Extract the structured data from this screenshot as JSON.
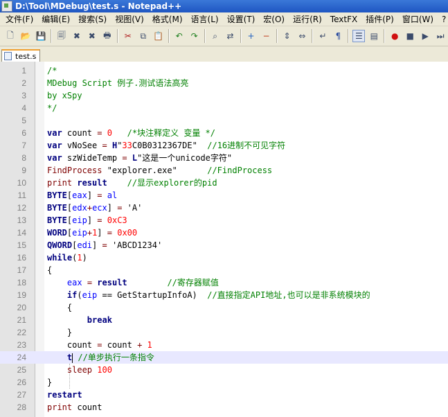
{
  "window": {
    "title": "D:\\Tool\\MDebug\\test.s - Notepad++"
  },
  "menu": [
    "文件(F)",
    "编辑(E)",
    "搜索(S)",
    "视图(V)",
    "格式(M)",
    "语言(L)",
    "设置(T)",
    "宏(O)",
    "运行(R)",
    "TextFX",
    "插件(P)",
    "窗口(W)",
    "?"
  ],
  "toolbar": {
    "icons": [
      "new-file-icon",
      "open-file-icon",
      "save-icon",
      "save-all-icon",
      "close-icon",
      "close-all-icon",
      "print-icon",
      "cut-icon",
      "copy-icon",
      "paste-icon",
      "undo-icon",
      "redo-icon",
      "find-icon",
      "replace-icon",
      "zoom-in-icon",
      "zoom-out-icon",
      "sync-v-icon",
      "sync-h-icon",
      "wrap-icon",
      "show-all-chars-icon",
      "indent-guide-icon",
      "udl-icon",
      "record-icon",
      "stop-icon",
      "play-icon",
      "run-multiple-icon"
    ]
  },
  "tabs": [
    {
      "label": "test.s",
      "active": true
    }
  ],
  "colors": {
    "comment": "#008000",
    "keyword": "#00007f",
    "function": "#7f0000",
    "number": "#ff0000",
    "variable": "#0000ff",
    "current_line": "#e8e8ff"
  },
  "editor": {
    "current_line": 24,
    "lines": [
      {
        "n": "1",
        "tokens": [
          {
            "c": "cm",
            "t": "/*"
          }
        ]
      },
      {
        "n": "2",
        "tokens": [
          {
            "c": "cm",
            "t": "MDebug Script 例子.测试语法高亮"
          }
        ]
      },
      {
        "n": "3",
        "tokens": [
          {
            "c": "cm",
            "t": "by xSpy"
          }
        ]
      },
      {
        "n": "4",
        "tokens": [
          {
            "c": "cm",
            "t": "*/"
          }
        ]
      },
      {
        "n": "5",
        "tokens": []
      },
      {
        "n": "6",
        "tokens": [
          {
            "c": "kw",
            "t": "var"
          },
          {
            "c": "op",
            "t": " count "
          },
          {
            "c": "fn",
            "t": "="
          },
          {
            "c": "op",
            "t": " "
          },
          {
            "c": "num",
            "t": "0"
          },
          {
            "c": "op",
            "t": "   "
          },
          {
            "c": "cm",
            "t": "/*块注释定义 变量 */"
          }
        ]
      },
      {
        "n": "7",
        "tokens": [
          {
            "c": "kw",
            "t": "var"
          },
          {
            "c": "op",
            "t": " vNoSee "
          },
          {
            "c": "fn",
            "t": "="
          },
          {
            "c": "op",
            "t": " "
          },
          {
            "c": "kw",
            "t": "H"
          },
          {
            "c": "str",
            "t": "\""
          },
          {
            "c": "num",
            "t": "33"
          },
          {
            "c": "str",
            "t": "C0B0312367DE\""
          },
          {
            "c": "op",
            "t": "  "
          },
          {
            "c": "cm",
            "t": "//16进制不可见字符"
          }
        ]
      },
      {
        "n": "8",
        "tokens": [
          {
            "c": "kw",
            "t": "var"
          },
          {
            "c": "op",
            "t": " szWideTemp "
          },
          {
            "c": "fn",
            "t": "="
          },
          {
            "c": "op",
            "t": " "
          },
          {
            "c": "kw",
            "t": "L"
          },
          {
            "c": "str",
            "t": "\"这是一个unicode字符\""
          }
        ]
      },
      {
        "n": "9",
        "tokens": [
          {
            "c": "fn",
            "t": "FindProcess"
          },
          {
            "c": "str",
            "t": " \"explorer.exe\""
          },
          {
            "c": "op",
            "t": "      "
          },
          {
            "c": "cm",
            "t": "//FindProcess"
          }
        ]
      },
      {
        "n": "10",
        "tokens": [
          {
            "c": "fn",
            "t": "print"
          },
          {
            "c": "op",
            "t": " "
          },
          {
            "c": "kw",
            "t": "result"
          },
          {
            "c": "op",
            "t": "    "
          },
          {
            "c": "cm",
            "t": "//显示explorer的pid"
          }
        ]
      },
      {
        "n": "11",
        "tokens": [
          {
            "c": "kw",
            "t": "BYTE"
          },
          {
            "c": "op",
            "t": "["
          },
          {
            "c": "var",
            "t": "eax"
          },
          {
            "c": "op",
            "t": "] "
          },
          {
            "c": "fn",
            "t": "="
          },
          {
            "c": "op",
            "t": " "
          },
          {
            "c": "var",
            "t": "al"
          }
        ]
      },
      {
        "n": "12",
        "tokens": [
          {
            "c": "kw",
            "t": "BYTE"
          },
          {
            "c": "op",
            "t": "["
          },
          {
            "c": "var",
            "t": "edx"
          },
          {
            "c": "fn",
            "t": "+"
          },
          {
            "c": "var",
            "t": "ecx"
          },
          {
            "c": "op",
            "t": "] "
          },
          {
            "c": "fn",
            "t": "="
          },
          {
            "c": "str",
            "t": " 'A'"
          }
        ]
      },
      {
        "n": "13",
        "tokens": [
          {
            "c": "kw",
            "t": "BYTE"
          },
          {
            "c": "op",
            "t": "["
          },
          {
            "c": "var",
            "t": "eip"
          },
          {
            "c": "op",
            "t": "] "
          },
          {
            "c": "fn",
            "t": "="
          },
          {
            "c": "op",
            "t": " "
          },
          {
            "c": "num",
            "t": "0xC3"
          }
        ]
      },
      {
        "n": "14",
        "tokens": [
          {
            "c": "kw",
            "t": "WORD"
          },
          {
            "c": "op",
            "t": "["
          },
          {
            "c": "var",
            "t": "eip"
          },
          {
            "c": "fn",
            "t": "+"
          },
          {
            "c": "num",
            "t": "1"
          },
          {
            "c": "op",
            "t": "] "
          },
          {
            "c": "fn",
            "t": "="
          },
          {
            "c": "op",
            "t": " "
          },
          {
            "c": "num",
            "t": "0x00"
          }
        ]
      },
      {
        "n": "15",
        "tokens": [
          {
            "c": "kw",
            "t": "QWORD"
          },
          {
            "c": "op",
            "t": "["
          },
          {
            "c": "var",
            "t": "edi"
          },
          {
            "c": "op",
            "t": "] "
          },
          {
            "c": "fn",
            "t": "="
          },
          {
            "c": "str",
            "t": " 'ABCD1234'"
          }
        ]
      },
      {
        "n": "16",
        "tokens": [
          {
            "c": "kw",
            "t": "while"
          },
          {
            "c": "op",
            "t": "("
          },
          {
            "c": "num",
            "t": "1"
          },
          {
            "c": "op",
            "t": ")"
          }
        ]
      },
      {
        "n": "17",
        "tokens": [
          {
            "c": "op",
            "t": "{"
          }
        ]
      },
      {
        "n": "18",
        "tokens": [
          {
            "c": "op",
            "t": "    "
          },
          {
            "c": "var",
            "t": "eax"
          },
          {
            "c": "op",
            "t": " "
          },
          {
            "c": "fn",
            "t": "="
          },
          {
            "c": "op",
            "t": " "
          },
          {
            "c": "kw",
            "t": "result"
          },
          {
            "c": "op",
            "t": "        "
          },
          {
            "c": "cm",
            "t": "//寄存器赋值"
          }
        ]
      },
      {
        "n": "19",
        "tokens": [
          {
            "c": "op",
            "t": "    "
          },
          {
            "c": "kw",
            "t": "if"
          },
          {
            "c": "op",
            "t": "("
          },
          {
            "c": "var",
            "t": "eip"
          },
          {
            "c": "op",
            "t": " == GetStartupInfoA)  "
          },
          {
            "c": "cm",
            "t": "//直接指定API地址,也可以是非系统模块的"
          }
        ]
      },
      {
        "n": "20",
        "tokens": [
          {
            "c": "op",
            "t": "    {"
          }
        ]
      },
      {
        "n": "21",
        "tokens": [
          {
            "c": "op",
            "t": "        "
          },
          {
            "c": "kw",
            "t": "break"
          }
        ]
      },
      {
        "n": "22",
        "tokens": [
          {
            "c": "op",
            "t": "    }"
          }
        ]
      },
      {
        "n": "23",
        "tokens": [
          {
            "c": "op",
            "t": "    count "
          },
          {
            "c": "fn",
            "t": "="
          },
          {
            "c": "op",
            "t": " count "
          },
          {
            "c": "fn",
            "t": "+"
          },
          {
            "c": "op",
            "t": " "
          },
          {
            "c": "num",
            "t": "1"
          }
        ]
      },
      {
        "n": "24",
        "tokens": [
          {
            "c": "op",
            "t": "    "
          },
          {
            "c": "kw",
            "t": "t"
          },
          {
            "c": "caret",
            "t": ""
          },
          {
            "c": "op",
            "t": " "
          },
          {
            "c": "cm",
            "t": "//单步执行一条指令"
          }
        ]
      },
      {
        "n": "25",
        "tokens": [
          {
            "c": "op",
            "t": "    "
          },
          {
            "c": "fn",
            "t": "sleep"
          },
          {
            "c": "op",
            "t": " "
          },
          {
            "c": "num",
            "t": "100"
          }
        ]
      },
      {
        "n": "26",
        "tokens": [
          {
            "c": "op",
            "t": "}"
          }
        ]
      },
      {
        "n": "27",
        "tokens": [
          {
            "c": "kw",
            "t": "restart"
          }
        ]
      },
      {
        "n": "28",
        "tokens": [
          {
            "c": "fn",
            "t": "print"
          },
          {
            "c": "op",
            "t": " count"
          }
        ]
      }
    ]
  }
}
